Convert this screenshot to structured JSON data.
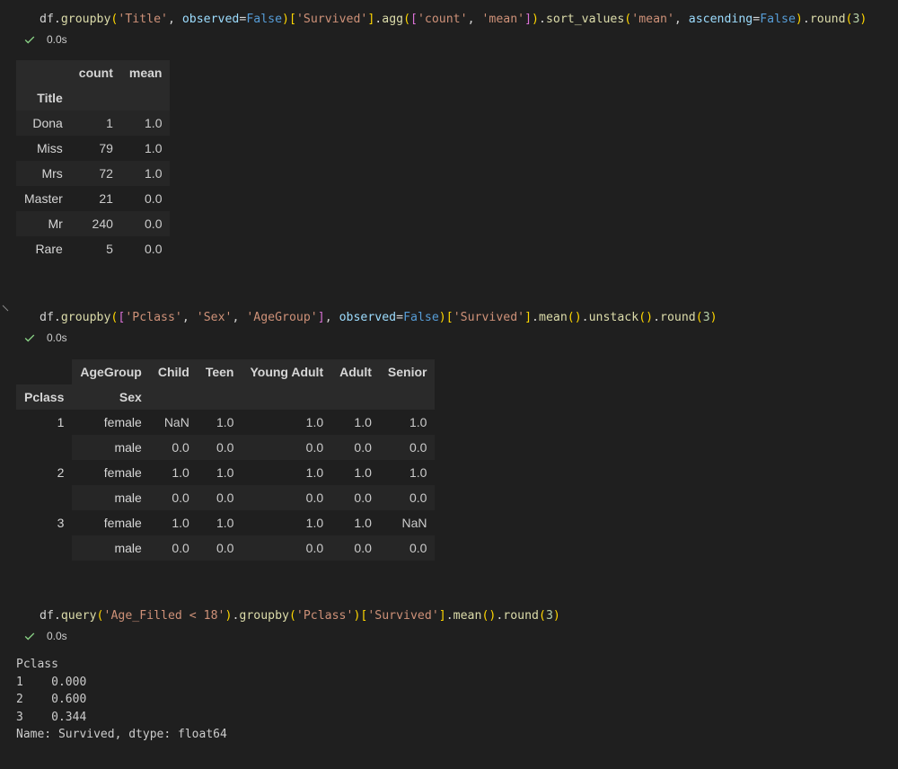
{
  "cells": [
    {
      "code_tokens": [
        {
          "t": "df",
          "c": "plain"
        },
        {
          "t": ".",
          "c": "plain"
        },
        {
          "t": "groupby",
          "c": "fn"
        },
        {
          "t": "(",
          "c": "br1"
        },
        {
          "t": "'Title'",
          "c": "str"
        },
        {
          "t": ", ",
          "c": "plain"
        },
        {
          "t": "observed",
          "c": "var"
        },
        {
          "t": "=",
          "c": "plain"
        },
        {
          "t": "False",
          "c": "kw"
        },
        {
          "t": ")",
          "c": "br1"
        },
        {
          "t": "[",
          "c": "br1"
        },
        {
          "t": "'Survived'",
          "c": "str"
        },
        {
          "t": "]",
          "c": "br1"
        },
        {
          "t": ".",
          "c": "plain"
        },
        {
          "t": "agg",
          "c": "fn"
        },
        {
          "t": "(",
          "c": "br1"
        },
        {
          "t": "[",
          "c": "br2"
        },
        {
          "t": "'count'",
          "c": "str"
        },
        {
          "t": ", ",
          "c": "plain"
        },
        {
          "t": "'mean'",
          "c": "str"
        },
        {
          "t": "]",
          "c": "br2"
        },
        {
          "t": ")",
          "c": "br1"
        },
        {
          "t": ".",
          "c": "plain"
        },
        {
          "t": "sort_values",
          "c": "fn"
        },
        {
          "t": "(",
          "c": "br1"
        },
        {
          "t": "'mean'",
          "c": "str"
        },
        {
          "t": ", ",
          "c": "plain"
        },
        {
          "t": "ascending",
          "c": "var"
        },
        {
          "t": "=",
          "c": "plain"
        },
        {
          "t": "False",
          "c": "kw"
        },
        {
          "t": ")",
          "c": "br1"
        },
        {
          "t": ".",
          "c": "plain"
        },
        {
          "t": "round",
          "c": "fn"
        },
        {
          "t": "(",
          "c": "br1"
        },
        {
          "t": "3",
          "c": "num"
        },
        {
          "t": ")",
          "c": "br1"
        }
      ],
      "exec_time": "0.0s",
      "table": {
        "columns": [
          "count",
          "mean"
        ],
        "index_name": "Title",
        "rows": [
          {
            "index": "Dona",
            "values": [
              "1",
              "1.0"
            ]
          },
          {
            "index": "Miss",
            "values": [
              "79",
              "1.0"
            ]
          },
          {
            "index": "Mrs",
            "values": [
              "72",
              "1.0"
            ]
          },
          {
            "index": "Master",
            "values": [
              "21",
              "0.0"
            ]
          },
          {
            "index": "Mr",
            "values": [
              "240",
              "0.0"
            ]
          },
          {
            "index": "Rare",
            "values": [
              "5",
              "0.0"
            ]
          }
        ]
      }
    },
    {
      "code_tokens": [
        {
          "t": "df",
          "c": "plain"
        },
        {
          "t": ".",
          "c": "plain"
        },
        {
          "t": "groupby",
          "c": "fn"
        },
        {
          "t": "(",
          "c": "br1"
        },
        {
          "t": "[",
          "c": "br2"
        },
        {
          "t": "'Pclass'",
          "c": "str"
        },
        {
          "t": ", ",
          "c": "plain"
        },
        {
          "t": "'Sex'",
          "c": "str"
        },
        {
          "t": ", ",
          "c": "plain"
        },
        {
          "t": "'AgeGroup'",
          "c": "str"
        },
        {
          "t": "]",
          "c": "br2"
        },
        {
          "t": ", ",
          "c": "plain"
        },
        {
          "t": "observed",
          "c": "var"
        },
        {
          "t": "=",
          "c": "plain"
        },
        {
          "t": "False",
          "c": "kw"
        },
        {
          "t": ")",
          "c": "br1"
        },
        {
          "t": "[",
          "c": "br1"
        },
        {
          "t": "'Survived'",
          "c": "str"
        },
        {
          "t": "]",
          "c": "br1"
        },
        {
          "t": ".",
          "c": "plain"
        },
        {
          "t": "mean",
          "c": "fn"
        },
        {
          "t": "()",
          "c": "br1"
        },
        {
          "t": ".",
          "c": "plain"
        },
        {
          "t": "unstack",
          "c": "fn"
        },
        {
          "t": "()",
          "c": "br1"
        },
        {
          "t": ".",
          "c": "plain"
        },
        {
          "t": "round",
          "c": "fn"
        },
        {
          "t": "(",
          "c": "br1"
        },
        {
          "t": "3",
          "c": "num"
        },
        {
          "t": ")",
          "c": "br1"
        }
      ],
      "exec_time": "0.0s",
      "table": {
        "columns_name": "AgeGroup",
        "columns": [
          "Child",
          "Teen",
          "Young Adult",
          "Adult",
          "Senior"
        ],
        "index_names": [
          "Pclass",
          "Sex"
        ],
        "rows": [
          {
            "pclass": "1",
            "sex": "female",
            "values": [
              "NaN",
              "1.0",
              "1.0",
              "1.0",
              "1.0"
            ]
          },
          {
            "pclass": "",
            "sex": "male",
            "values": [
              "0.0",
              "0.0",
              "0.0",
              "0.0",
              "0.0"
            ]
          },
          {
            "pclass": "2",
            "sex": "female",
            "values": [
              "1.0",
              "1.0",
              "1.0",
              "1.0",
              "1.0"
            ]
          },
          {
            "pclass": "",
            "sex": "male",
            "values": [
              "0.0",
              "0.0",
              "0.0",
              "0.0",
              "0.0"
            ]
          },
          {
            "pclass": "3",
            "sex": "female",
            "values": [
              "1.0",
              "1.0",
              "1.0",
              "1.0",
              "NaN"
            ]
          },
          {
            "pclass": "",
            "sex": "male",
            "values": [
              "0.0",
              "0.0",
              "0.0",
              "0.0",
              "0.0"
            ]
          }
        ]
      }
    },
    {
      "code_tokens": [
        {
          "t": "df",
          "c": "plain"
        },
        {
          "t": ".",
          "c": "plain"
        },
        {
          "t": "query",
          "c": "fn"
        },
        {
          "t": "(",
          "c": "br1"
        },
        {
          "t": "'Age_Filled < 18'",
          "c": "str"
        },
        {
          "t": ")",
          "c": "br1"
        },
        {
          "t": ".",
          "c": "plain"
        },
        {
          "t": "groupby",
          "c": "fn"
        },
        {
          "t": "(",
          "c": "br1"
        },
        {
          "t": "'Pclass'",
          "c": "str"
        },
        {
          "t": ")",
          "c": "br1"
        },
        {
          "t": "[",
          "c": "br1"
        },
        {
          "t": "'Survived'",
          "c": "str"
        },
        {
          "t": "]",
          "c": "br1"
        },
        {
          "t": ".",
          "c": "plain"
        },
        {
          "t": "mean",
          "c": "fn"
        },
        {
          "t": "()",
          "c": "br1"
        },
        {
          "t": ".",
          "c": "plain"
        },
        {
          "t": "round",
          "c": "fn"
        },
        {
          "t": "(",
          "c": "br1"
        },
        {
          "t": "3",
          "c": "num"
        },
        {
          "t": ")",
          "c": "br1"
        }
      ],
      "exec_time": "0.0s",
      "text_output": [
        "Pclass",
        "1    0.000",
        "2    0.600",
        "3    0.344",
        "Name: Survived, dtype: float64"
      ]
    }
  ],
  "icons": {
    "check": "check-icon",
    "collapse": "chevron-collapse-icon"
  },
  "colors": {
    "background": "#1f1f1f",
    "check": "#89d185"
  }
}
